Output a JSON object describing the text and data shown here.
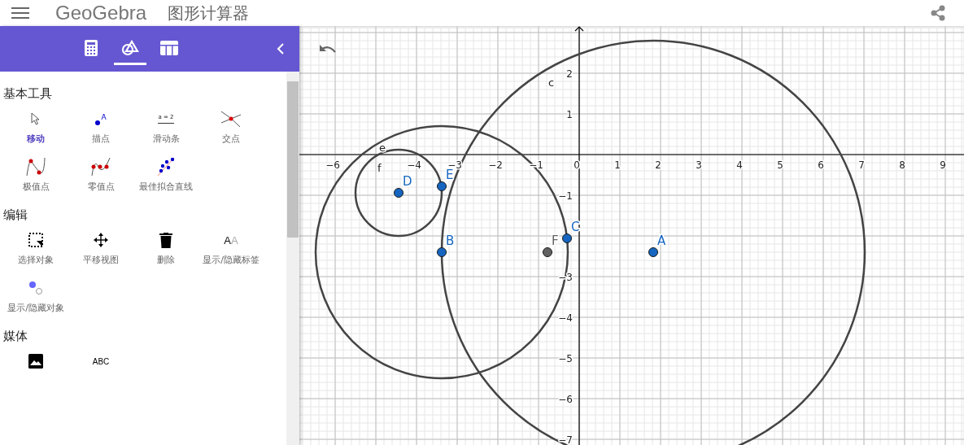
{
  "header": {
    "logo": "GeoGebra",
    "app_title": "图形计算器"
  },
  "sidebar": {
    "tabs": [
      {
        "kind": "calculator",
        "selected": false
      },
      {
        "kind": "geometry",
        "selected": true
      },
      {
        "kind": "table",
        "selected": false
      }
    ],
    "sections": [
      {
        "title": "基本工具",
        "tools": [
          {
            "kind": "move",
            "label": "移动",
            "selected": true
          },
          {
            "kind": "point",
            "label": "描点",
            "icon_text": [
              "A"
            ],
            "selected": false
          },
          {
            "kind": "slider",
            "label": "滑动条",
            "icon_text": [
              "a = 2"
            ],
            "selected": false
          },
          {
            "kind": "intersect",
            "label": "交点",
            "selected": false
          },
          {
            "kind": "extremum",
            "label": "极值点",
            "selected": false
          },
          {
            "kind": "roots",
            "label": "零值点",
            "selected": false
          },
          {
            "kind": "fit-line",
            "label": "最佳拟合直线",
            "selected": false
          }
        ]
      },
      {
        "title": "编辑",
        "tools": [
          {
            "kind": "select",
            "label": "选择对象",
            "selected": false
          },
          {
            "kind": "pan",
            "label": "平移视图",
            "selected": false
          },
          {
            "kind": "delete",
            "label": "删除",
            "selected": false
          },
          {
            "kind": "label-toggle",
            "label": "显示/隐藏标签",
            "icon_text": [
              "A",
              "A"
            ],
            "selected": false
          },
          {
            "kind": "object-toggle",
            "label": "显示/隐藏对象",
            "selected": false
          }
        ]
      },
      {
        "title": "媒体",
        "tools": [
          {
            "kind": "image",
            "selected": false
          },
          {
            "kind": "text",
            "icon_text": [
              "ABC"
            ],
            "selected": false
          }
        ]
      }
    ]
  },
  "graphics": {
    "x_axis_labels": [
      "−6",
      "−4",
      "−3",
      "−2",
      "−1",
      "0",
      "1",
      "2",
      "3",
      "4",
      "5",
      "6",
      "7",
      "8",
      "9"
    ],
    "y_axis_labels": [
      "2",
      "1",
      "−1",
      "−3",
      "−4",
      "−5",
      "−6",
      "−7"
    ],
    "points": [
      {
        "name": "D",
        "color": "#1565c0"
      },
      {
        "name": "E",
        "color": "#1565c0"
      },
      {
        "name": "B",
        "color": "#1565c0"
      },
      {
        "name": "F",
        "color": "#616161"
      },
      {
        "name": "C",
        "color": "#1565c0"
      },
      {
        "name": "A",
        "color": "#1565c0"
      }
    ],
    "circle_labels": [
      "c",
      "e",
      "f"
    ]
  }
}
